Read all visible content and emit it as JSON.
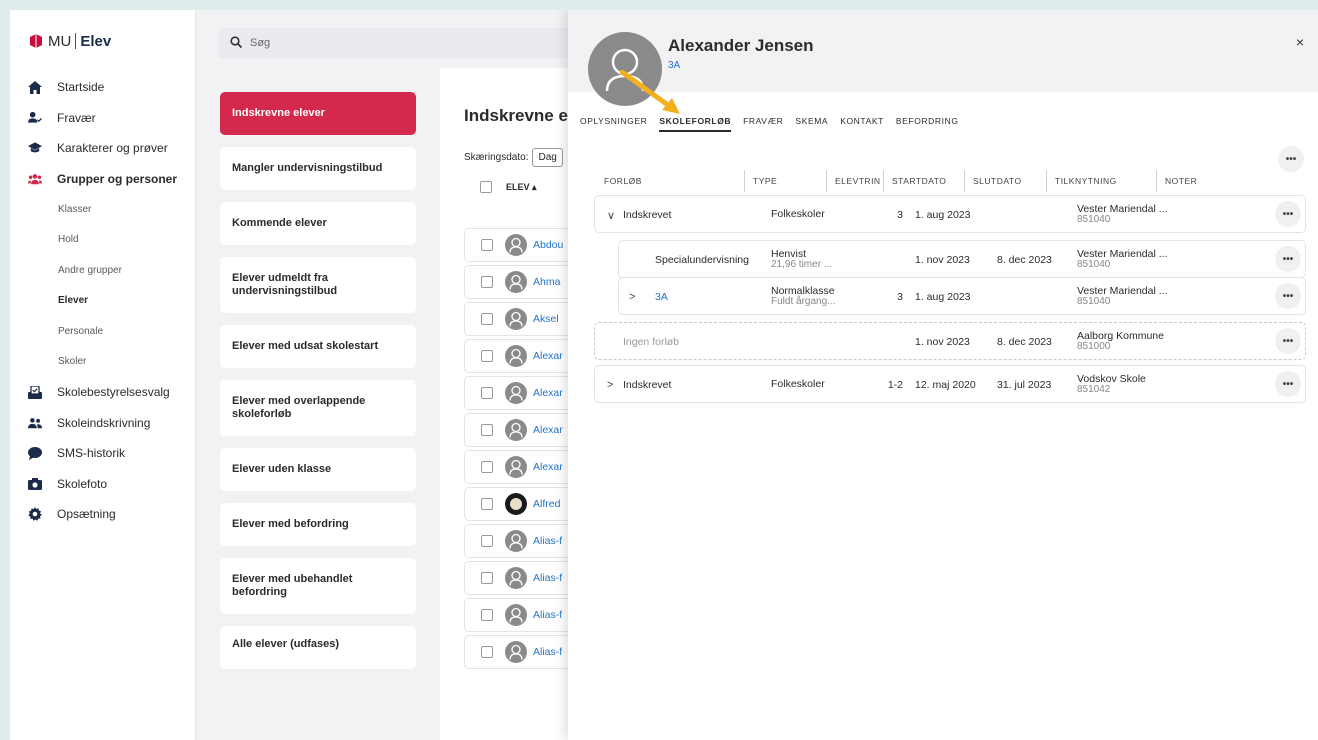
{
  "brand": {
    "mu": "MU",
    "elev": "Elev"
  },
  "nav": {
    "items": [
      {
        "label": "Startside",
        "icon": "home-icon"
      },
      {
        "label": "Fravær",
        "icon": "user-check-icon"
      },
      {
        "label": "Karakterer og prøver",
        "icon": "graduation-cap-icon"
      },
      {
        "label": "Grupper og personer",
        "icon": "users-icon"
      }
    ],
    "sub": [
      "Klasser",
      "Hold",
      "Andre grupper",
      "Elever",
      "Personale",
      "Skoler"
    ],
    "items2": [
      {
        "label": "Skolebestyrelsesvalg",
        "icon": "ballot-icon"
      },
      {
        "label": "Skoleindskrivning",
        "icon": "group-icon"
      },
      {
        "label": "SMS-historik",
        "icon": "chat-icon"
      },
      {
        "label": "Skolefoto",
        "icon": "camera-icon"
      },
      {
        "label": "Opsætning",
        "icon": "gear-icon"
      }
    ]
  },
  "search": {
    "placeholder": "Søg"
  },
  "categories": [
    "Indskrevne elever",
    "Mangler undervisningstilbud",
    "Kommende elever",
    "Elever udmeldt fra undervisningstilbud",
    "Elever med udsat skolestart",
    "Elever med overlappende skoleforløb",
    "Elever uden klasse",
    "Elever med befordring",
    "Elever med ubehandlet befordring",
    "Alle elever (udfases)"
  ],
  "list": {
    "title": "Indskrevne e",
    "date_label": "Skæringsdato:",
    "date_value": "Dag",
    "col_header": "ELEV ▴",
    "rows": [
      "Abdou",
      "Ahma",
      "Aksel",
      "Alexar",
      "Alexar",
      "Alexar",
      "Alexar",
      "Alfred",
      "Alias-f",
      "Alias-f",
      "Alias-f",
      "Alias-f"
    ]
  },
  "panel": {
    "name": "Alexander Jensen",
    "class": "3A",
    "close": "×",
    "tabs": [
      "OPLYSNINGER",
      "SKOLEFORLØB",
      "FRAVÆR",
      "SKEMA",
      "KONTAKT",
      "BEFORDRING"
    ],
    "columns": [
      "FORLØB",
      "TYPE",
      "ELEVTRIN",
      "STARTDATO",
      "SLUTDATO",
      "TILKNYTNING",
      "NOTER"
    ],
    "more": "•••",
    "rows": [
      {
        "chev": "∨",
        "forlob": "Indskrevet",
        "type": "Folkeskoler",
        "type2": "",
        "trin": "3",
        "start": "1. aug 2023",
        "slut": "",
        "til": "Vester Mariendal ...",
        "til2": "851040"
      },
      {
        "chev": "",
        "forlob": "Specialundervisning",
        "type": "Henvist",
        "type2": "21,96 timer ...",
        "trin": "",
        "start": "1. nov 2023",
        "slut": "8. dec 2023",
        "til": "Vester Mariendal ...",
        "til2": "851040"
      },
      {
        "chev": ">",
        "forlob": "3A",
        "type": "Normalklasse",
        "type2": "Fuldt årgang...",
        "trin": "3",
        "start": "1. aug 2023",
        "slut": "",
        "til": "Vester Mariendal ...",
        "til2": "851040"
      },
      {
        "chev": "",
        "forlob": "Ingen forløb",
        "type": "",
        "type2": "",
        "trin": "",
        "start": "1. nov 2023",
        "slut": "8. dec 2023",
        "til": "Aalborg Kommune",
        "til2": "851000"
      },
      {
        "chev": ">",
        "forlob": "Indskrevet",
        "type": "Folkeskoler",
        "type2": "",
        "trin": "1-2",
        "start": "12. maj 2020",
        "slut": "31. jul 2023",
        "til": "Vodskov Skole",
        "til2": "851042"
      }
    ]
  }
}
